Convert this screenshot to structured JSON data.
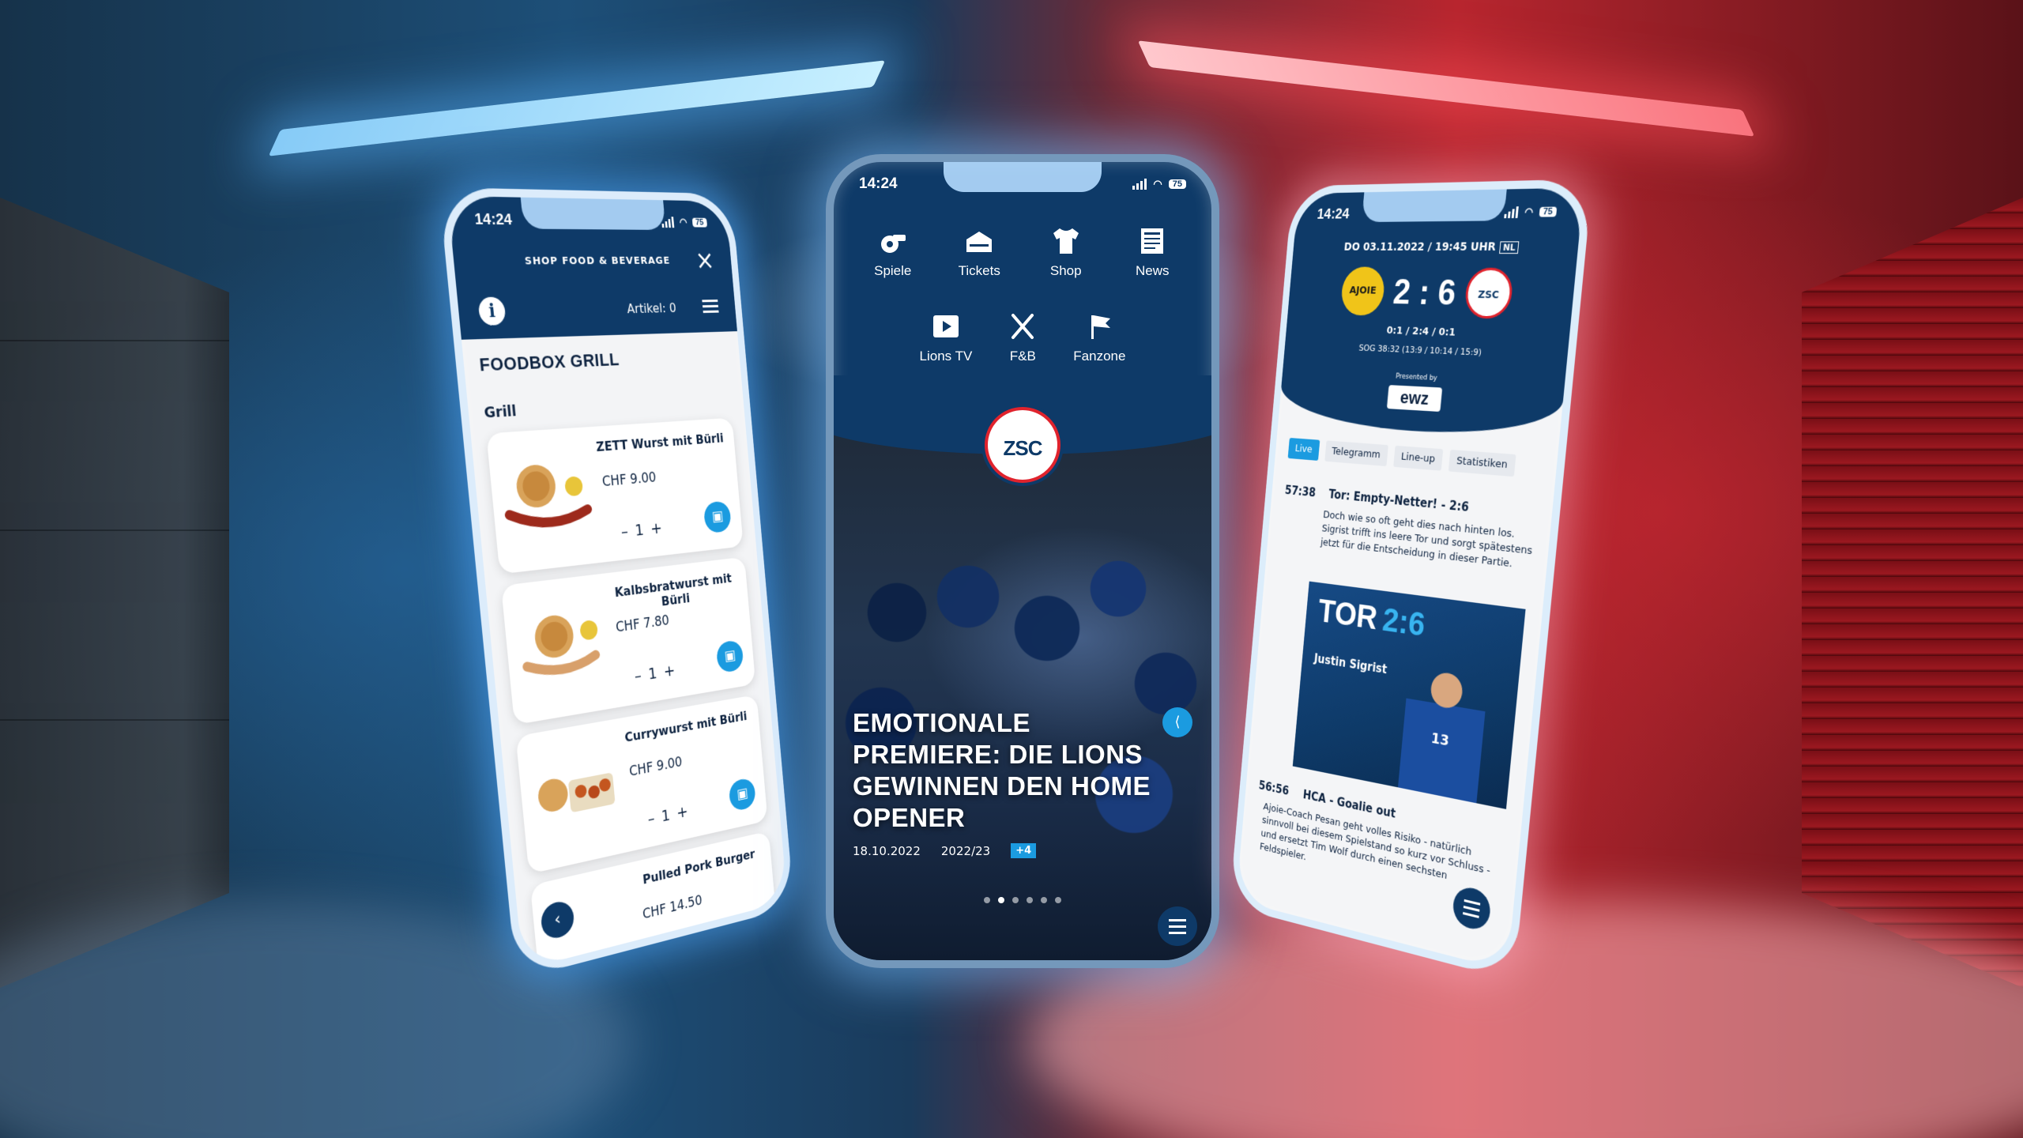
{
  "left_phone": {
    "status_time": "14:24",
    "battery": "75",
    "header_title": "SHOP FOOD & BEVERAGE",
    "close_icon": "close-icon",
    "info_label": "i",
    "cart_count_label": "Artikel: 0",
    "shop_title": "FOODBOX GRILL",
    "category": "Grill",
    "items": [
      {
        "name": "ZETT Wurst mit Bürli",
        "price": "CHF 9.00",
        "qty": "1"
      },
      {
        "name": "Kalbsbratwurst mit Bürli",
        "price": "CHF 7.80",
        "qty": "1"
      },
      {
        "name": "Currywurst mit Bürli",
        "price": "CHF 9.00",
        "qty": "1"
      },
      {
        "name": "Pulled Pork Burger",
        "price": "CHF 14.50",
        "qty": ""
      }
    ],
    "qty_minus": "–",
    "qty_plus": "+",
    "back_icon": "‹"
  },
  "center_phone": {
    "status_time": "14:24",
    "battery": "75",
    "menu": [
      {
        "label": "Spiele",
        "icon": "whistle-icon"
      },
      {
        "label": "Tickets",
        "icon": "stadium-icon"
      },
      {
        "label": "Shop",
        "icon": "jersey-icon"
      },
      {
        "label": "News",
        "icon": "newspaper-icon"
      },
      {
        "label": "Lions TV",
        "icon": "play-icon"
      },
      {
        "label": "F&B",
        "icon": "cutlery-icon"
      },
      {
        "label": "Fanzone",
        "icon": "flag-icon"
      }
    ],
    "logo_text": "ZSC",
    "headline": "EMOTIONALE PREMIERE: DIE LIONS GEWINNEN DEN HOME OPENER",
    "date": "18.10.2022",
    "season": "2022/23",
    "more_tag": "+4",
    "carousel_count": 6,
    "carousel_active": 1
  },
  "right_phone": {
    "status_time": "14:24",
    "battery": "75",
    "date": "DO 03.11.2022 / 19:45 UHR",
    "lang": "NL",
    "team_home": "AJOIE",
    "team_away": "ZSC",
    "score": "2 : 6",
    "periods": "0:1 / 2:4 / 0:1",
    "sog": "SOG 38:32 (13:9 / 10:14 / 15:9)",
    "presented_by": "Presented by",
    "sponsor": "ewz",
    "tabs": [
      "Live",
      "Telegramm",
      "Line-up",
      "Statistiken"
    ],
    "event1": {
      "time": "57:38",
      "title": "Tor: Empty-Netter! - 2:6",
      "text": "Doch wie so oft geht dies nach hinten los. Sigrist trifft ins leere Tor und sorgt spätestens jetzt für die Entscheidung in dieser Partie."
    },
    "tor_label": "TOR",
    "tor_score": "2:6",
    "scorer": "Justin Sigrist",
    "jersey_number": "13",
    "event2": {
      "time": "56:56",
      "title": "HCA - Goalie out",
      "text": "Ajoie-Coach Pesan geht volles Risiko - natürlich sinnvoll bei diesem Spielstand so kurz vor Schluss - und ersetzt Tim Wolf durch einen sechsten Feldspieler."
    }
  },
  "colors": {
    "brand_blue": "#0e3a68",
    "accent_blue": "#1b9be0",
    "accent_red": "#e0232d"
  }
}
